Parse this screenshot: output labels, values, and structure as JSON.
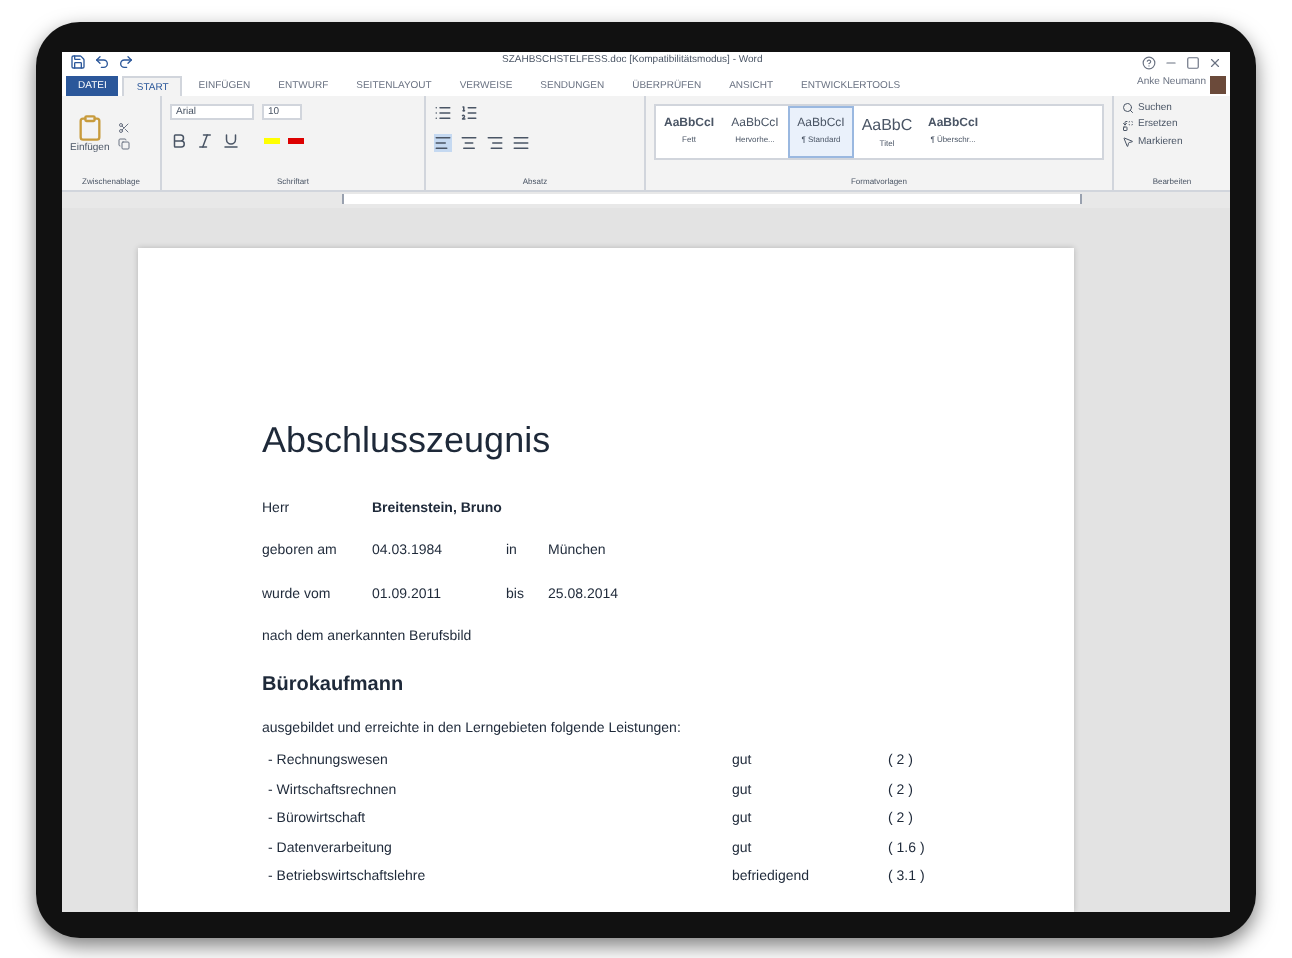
{
  "window": {
    "title": "SZAHBSCHSTELFESS.doc [Kompatibilitätsmodus] - Word"
  },
  "tabs": [
    {
      "label": "DATEI",
      "kind": "file",
      "selected": false
    },
    {
      "label": "START",
      "kind": "tab",
      "selected": true
    },
    {
      "label": "EINFÜGEN",
      "kind": "tab",
      "selected": false
    },
    {
      "label": "ENTWURF",
      "kind": "tab",
      "selected": false
    },
    {
      "label": "SEITENLAYOUT",
      "kind": "tab",
      "selected": false
    },
    {
      "label": "VERWEISE",
      "kind": "tab",
      "selected": false
    },
    {
      "label": "SENDUNGEN",
      "kind": "tab",
      "selected": false
    },
    {
      "label": "ÜBERPRÜFEN",
      "kind": "tab",
      "selected": false
    },
    {
      "label": "ANSICHT",
      "kind": "tab",
      "selected": false
    },
    {
      "label": "ENTWICKLERTOOLS",
      "kind": "tab",
      "selected": false
    }
  ],
  "user": {
    "name": "Anke Neumann"
  },
  "ribbon": {
    "clipboard": {
      "paste": "Einfügen",
      "group": "Zwischenablage"
    },
    "font": {
      "family": "Arial",
      "size": "10",
      "group": "Schriftart"
    },
    "paragraph": {
      "group": "Absatz"
    },
    "styles": {
      "group": "Formatvorlagen",
      "items": [
        {
          "preview": "AaBbCcI",
          "name": "Fett",
          "selected": false
        },
        {
          "preview": "AaBbCcI",
          "name": "Hervorhe...",
          "selected": false
        },
        {
          "preview": "AaBbCcI",
          "name": "¶ Standard",
          "selected": true
        },
        {
          "preview": "AaBbC",
          "name": "Titel",
          "selected": false
        },
        {
          "preview": "AaBbCcI",
          "name": "¶ Überschr...",
          "selected": false
        }
      ]
    },
    "editing": {
      "group": "Bearbeiten",
      "items": [
        "Suchen",
        "Ersetzen",
        "Markieren"
      ]
    }
  },
  "document": {
    "title": "Abschlusszeugnis",
    "salutation": "Herr",
    "name": "Breitenstein, Bruno",
    "rows": [
      [
        "geboren am",
        "04.03.1984",
        "in",
        "München"
      ],
      [
        "wurde vom",
        "01.09.2011",
        "bis",
        "25.08.2014"
      ]
    ],
    "note": "nach dem anerkannten Berufsbild",
    "profession": "Bürokaufmann",
    "intro": "ausgebildet und erreichte in den Lerngebieten folgende Leistungen:",
    "grades": [
      {
        "subject": "- Rechnungswesen",
        "grade": "gut",
        "score": "( 2 )"
      },
      {
        "subject": "- Wirtschaftsrechnen",
        "grade": "gut",
        "score": "( 2 )"
      },
      {
        "subject": "- Bürowirtschaft",
        "grade": "gut",
        "score": "( 2 )"
      },
      {
        "subject": "- Datenverarbeitung",
        "grade": "gut",
        "score": "( 1.6 )"
      },
      {
        "subject": "- Betriebswirtschaftslehre",
        "grade": "befriedigend",
        "score": "( 3.1 )"
      }
    ]
  }
}
